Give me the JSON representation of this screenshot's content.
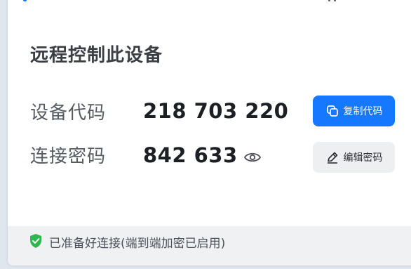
{
  "window": {
    "title": "远程控制此设备"
  },
  "device_code": {
    "label": "设备代码",
    "value": "218 703 220",
    "copy_button_label": "复制代码"
  },
  "password": {
    "label": "连接密码",
    "value": "842 633",
    "edit_button_label": "编辑密码"
  },
  "status": {
    "text": "已准备好连接(端到端加密已启用)"
  },
  "colors": {
    "accent": "#1677ff",
    "success": "#2eb84b",
    "footer_bg": "#eff1f3"
  },
  "icons": {
    "copy": "copy-icon",
    "edit": "pencil-icon",
    "reveal": "eye-icon",
    "status": "shield-check-icon"
  }
}
